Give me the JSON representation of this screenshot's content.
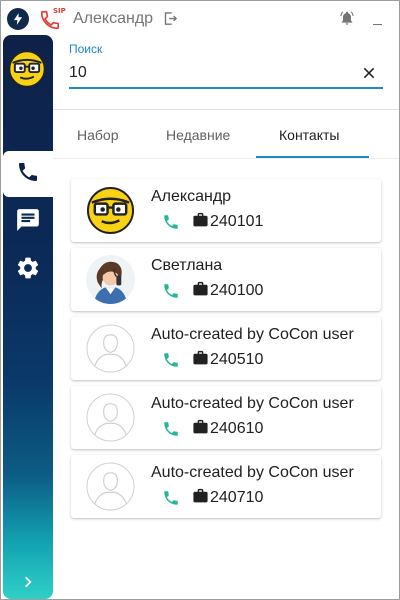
{
  "titlebar": {
    "app_icon": "lightning-icon",
    "sip_badge": "SIP",
    "user_name": "Александр",
    "logout_icon": "logout-icon",
    "bell_icon": "bell-icon",
    "minimize_icon": "minimize-icon"
  },
  "sidebar": {
    "items": [
      {
        "name": "phone-icon",
        "active": true
      },
      {
        "name": "chat-icon",
        "active": false
      },
      {
        "name": "gear-icon",
        "active": false
      }
    ],
    "expand_icon": "chevron-right-icon"
  },
  "search": {
    "label": "Поиск",
    "value": "10",
    "clear_icon": "close-icon"
  },
  "tabs": [
    {
      "label": "Набор",
      "active": false
    },
    {
      "label": "Недавние",
      "active": false
    },
    {
      "label": "Контакты",
      "active": true
    }
  ],
  "contacts": [
    {
      "name": "Александр",
      "number": "240101",
      "avatar": "smiley-glasses"
    },
    {
      "name": "Светлана",
      "number": "240100",
      "avatar": "photo"
    },
    {
      "name": "Auto-created by CoCon user",
      "number": "240510",
      "avatar": "placeholder"
    },
    {
      "name": "Auto-created by CoCon user",
      "number": "240610",
      "avatar": "placeholder"
    },
    {
      "name": "Auto-created by CoCon user",
      "number": "240710",
      "avatar": "placeholder"
    }
  ],
  "colors": {
    "accent": "#1e88c8",
    "call_green": "#26b598",
    "sip_red": "#e53935",
    "sidebar_top": "#0e2148",
    "sidebar_bottom": "#2fd0c8"
  }
}
